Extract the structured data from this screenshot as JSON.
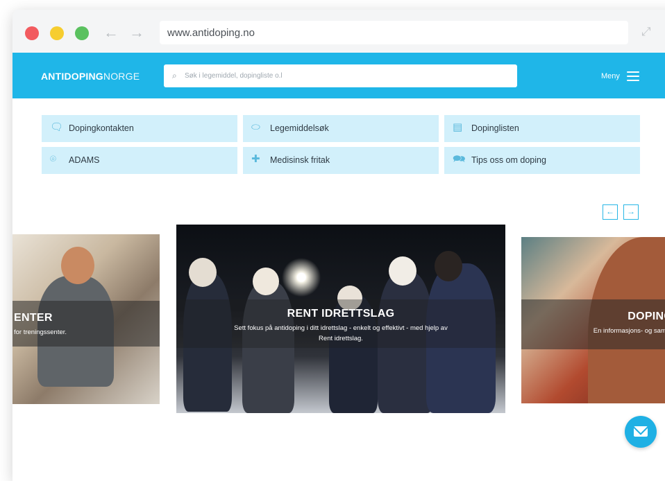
{
  "browser": {
    "url": "www.antidoping.no"
  },
  "site": {
    "logo_bold": "ANTIDOPING",
    "logo_thin": "NORGE",
    "search_placeholder": "Søk i legemiddel, dopingliste o.l",
    "menu_label": "Meny"
  },
  "quick_links": [
    {
      "label": "Dopingkontakten",
      "icon": "chat-bubble-icon"
    },
    {
      "label": "Legemiddelsøk",
      "icon": "pill-icon"
    },
    {
      "label": "Dopinglisten",
      "icon": "document-icon"
    },
    {
      "label": "ADAMS",
      "icon": "location-pin-icon"
    },
    {
      "label": "Medisinsk fritak",
      "icon": "medical-cross-icon"
    },
    {
      "label": "Tips oss om doping",
      "icon": "chat-bubbles-icon"
    }
  ],
  "carousel": {
    "prev_symbol": "←",
    "next_symbol": "→",
    "slides": [
      {
        "title": "ENTER",
        "subtitle": "for treningssenter."
      },
      {
        "title": "RENT IDRETTSLAG",
        "subtitle": "Sett fokus på antidoping i ditt idrettslag - enkelt og effektivt - med hjelp av Rent idrettslag."
      },
      {
        "title": "DOPINGK",
        "subtitle": "En informasjons- og sam og b"
      }
    ]
  },
  "colors": {
    "brand": "#1fb6e8",
    "tile_bg": "#d2f0fb"
  }
}
